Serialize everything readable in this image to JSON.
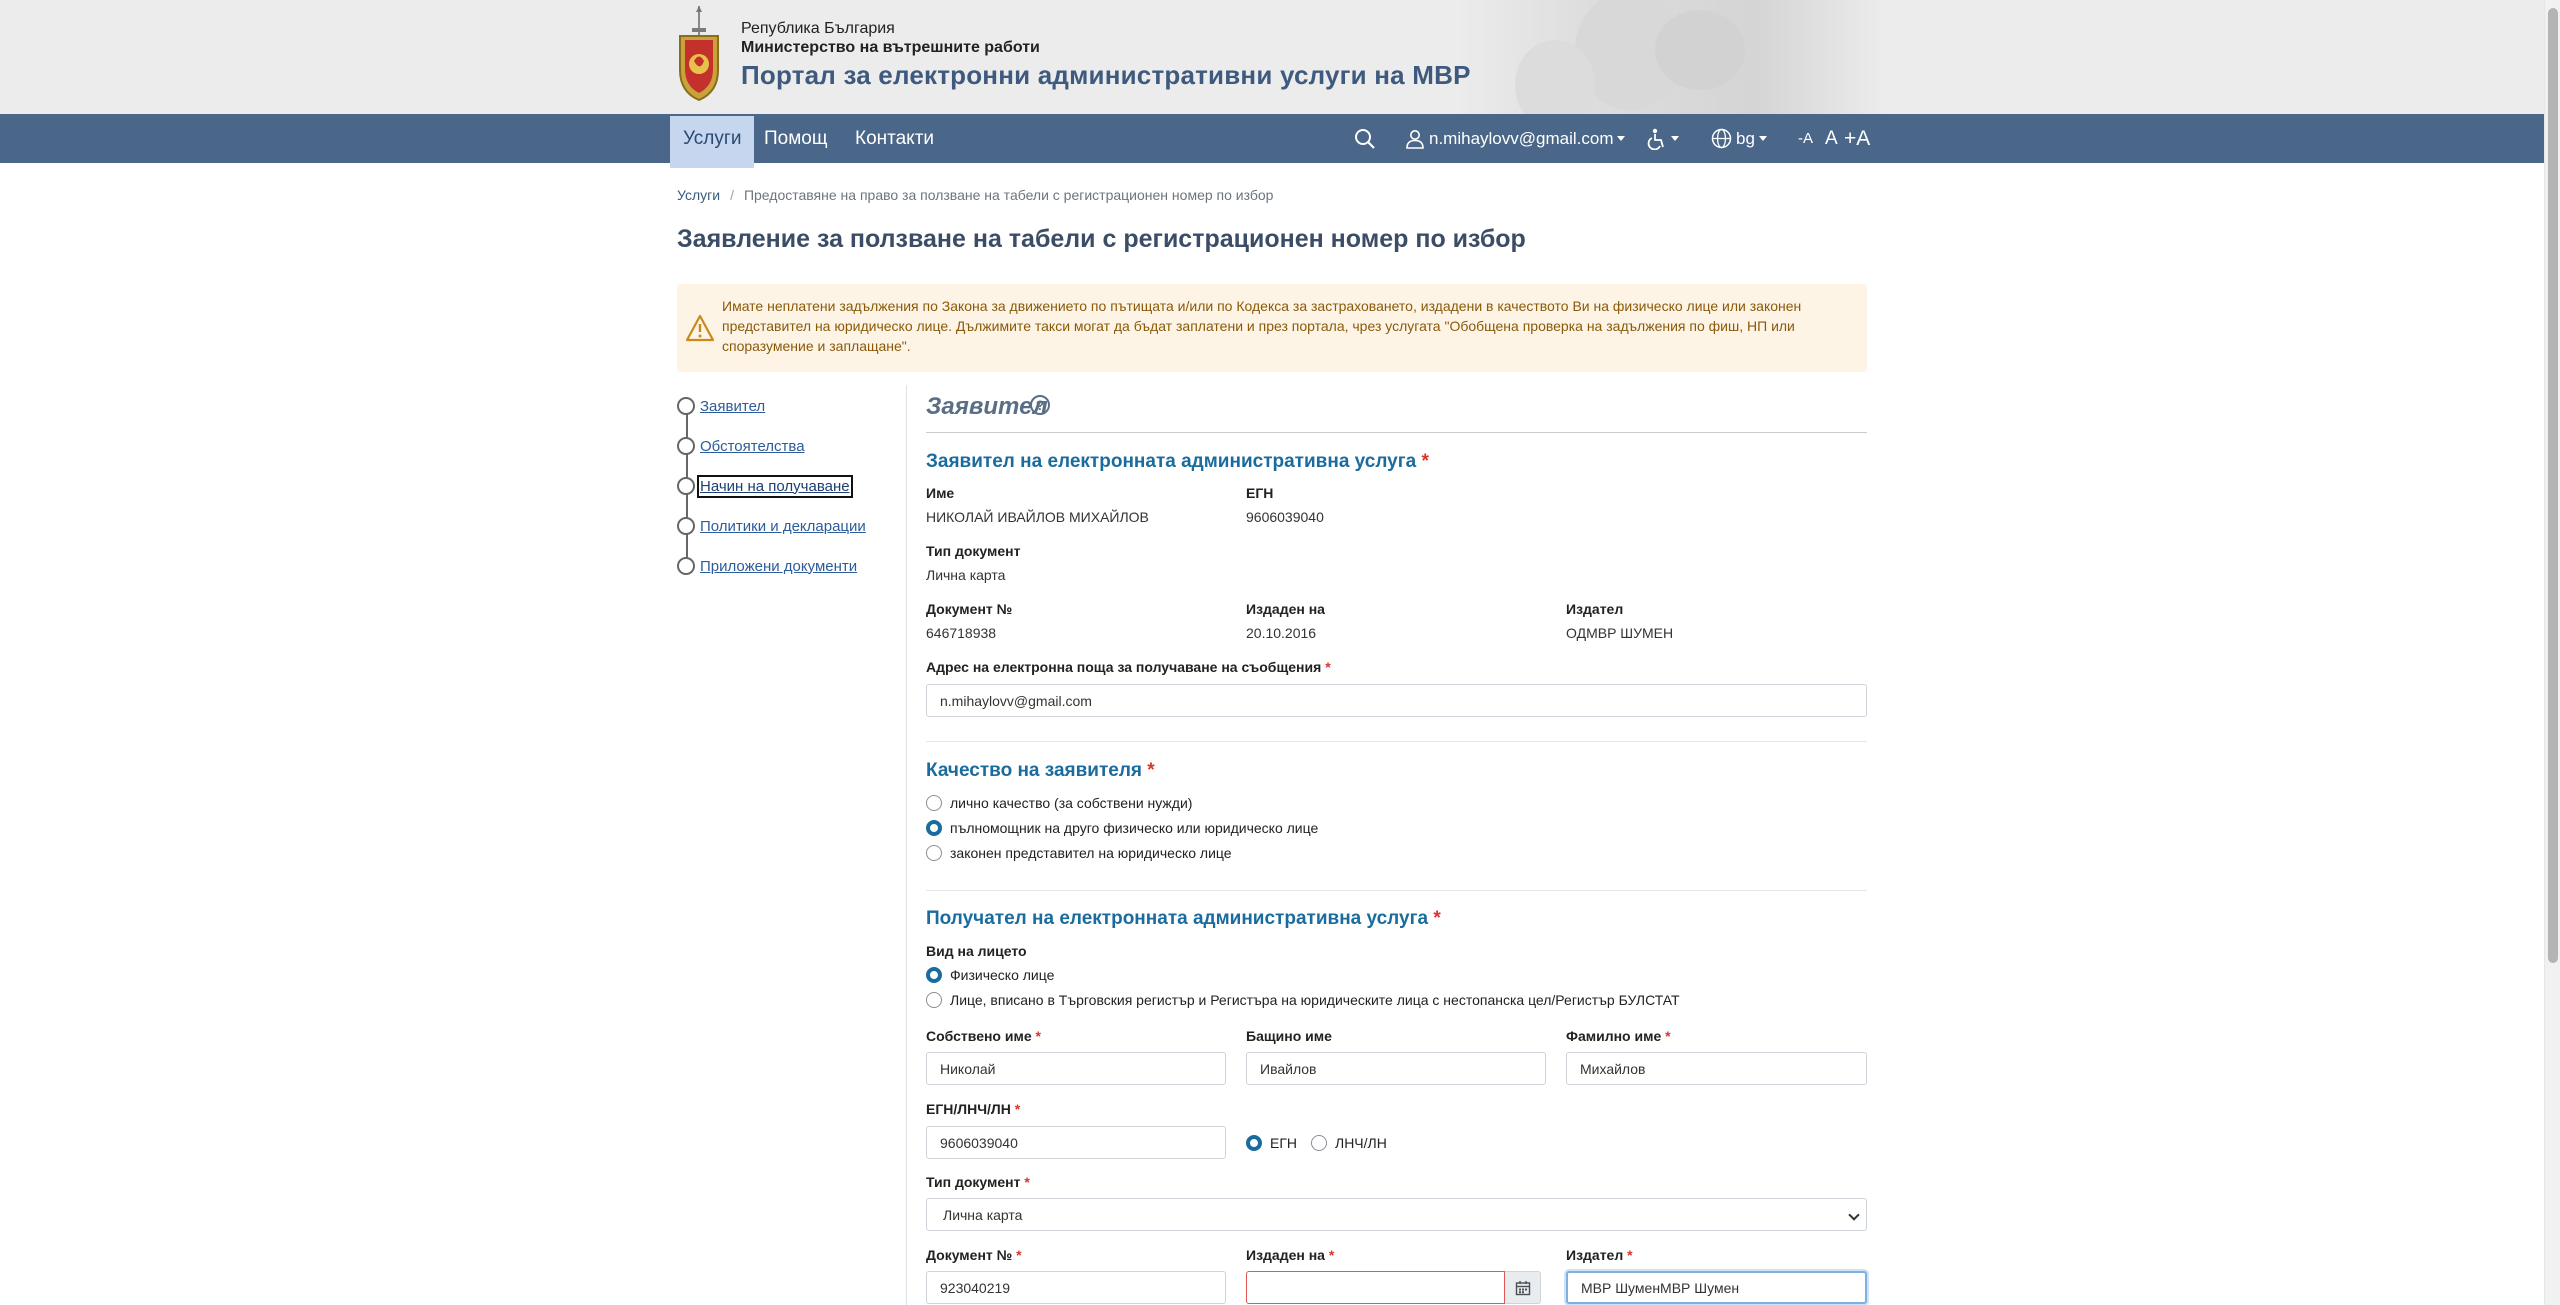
{
  "header": {
    "line1": "Република България",
    "line2": "Министерство на вътрешните работи",
    "title": "Портал за електронни административни услуги на МВР"
  },
  "nav": {
    "items": [
      "Услуги",
      "Помощ",
      "Контакти"
    ],
    "user": "n.mihaylovv@gmail.com",
    "language": "bg",
    "font_sizes": [
      "-A",
      "A",
      "+A"
    ]
  },
  "breadcrumb": {
    "root": "Услуги",
    "current": "Предоставяне на право за ползване на табели с регистрационен номер по избор"
  },
  "page_title": "Заявление за ползване на табели с регистрационен номер по избор",
  "alert_text": "Имате неплатени задължения по Закона за движението по пътищата и/или по Кодекса за застраховането, издадени в качеството Ви на физическо лице или законен представител на юридическо лице. Дължимите такси могат да бъдат заплатени и през портала, чрез услугата \"Обобщена проверка на задължения по фиш, НП или споразумение и заплащане\".",
  "steps": [
    "Заявител",
    "Обстоятелства",
    "Начин на получаване",
    "Политики и декларации",
    "Приложени документи"
  ],
  "section": {
    "title": "Заявител",
    "help": "?"
  },
  "applicant": {
    "heading": "Заявител на електронната административна услуга",
    "req": "*",
    "name_label": "Име",
    "name": "НИКОЛАЙ ИВАЙЛОВ МИХАЙЛОВ",
    "egn_label": "ЕГН",
    "egn": "9606039040",
    "doc_type_label": "Тип документ",
    "doc_type": "Лична карта",
    "doc_no_label": "Документ №",
    "doc_no": "646718938",
    "issued_on_label": "Издаден на",
    "issued_on": "20.10.2016",
    "issuer_label": "Издател",
    "issuer": "ОДМВР ШУМЕН",
    "email_label": "Адрес на електронна поща за получаване на съобщения",
    "email": "n.mihaylovv@gmail.com"
  },
  "quality": {
    "heading": "Качество на заявителя",
    "options": [
      "лично качество (за собствени нужди)",
      "пълномощник на друго физическо или юридическо лице",
      "законен представител на юридическо лице"
    ],
    "selected": 1
  },
  "recipient": {
    "heading": "Получател на електронната административна услуга",
    "kind_label": "Вид на лицето",
    "kind_options": [
      "Физическо лице",
      "Лице, вписано в Търговския регистър и Регистъра на юридическите лица с нестопанска цел/Регистър БУЛСТАТ"
    ],
    "first_name_label": "Собствено име",
    "first_name": "Николай",
    "middle_name_label": "Бащино име",
    "middle_name": "Ивайлов",
    "last_name_label": "Фамилно име",
    "last_name": "Михайлов",
    "id_label": "ЕГН/ЛНЧ/ЛН",
    "id_value": "9606039040",
    "id_type_options": [
      "ЕГН",
      "ЛНЧ/ЛН"
    ],
    "doc_type_label": "Тип документ",
    "doc_type": "Лична карта",
    "doc_no_label": "Документ №",
    "doc_no": "923040219",
    "issued_on_label": "Издаден на",
    "issued_on": "",
    "issuer_label": "Издател",
    "issuer": "МВР ШуменМВР Шумен"
  },
  "colors": {
    "nav_bg": "#4a6688",
    "heading_blue": "#1b6c9e",
    "required_red": "#d9352b",
    "alert_bg": "#fdf4e6"
  }
}
